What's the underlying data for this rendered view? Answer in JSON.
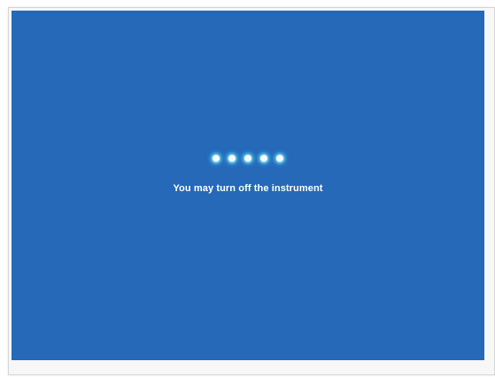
{
  "screen": {
    "background_color": "#2569b8",
    "progress_dots": {
      "count": 5,
      "color": "#ffffff",
      "glow_color": "#7fe6ff"
    },
    "message": "You may turn off the instrument"
  }
}
